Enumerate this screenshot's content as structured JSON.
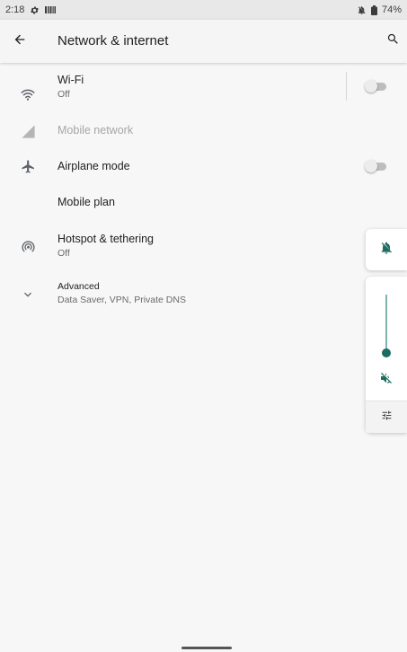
{
  "status_bar": {
    "time": "2:18",
    "battery": "74%",
    "icons": [
      "settings-gear-icon",
      "barcode-notification-icon",
      "notifications-off-icon",
      "battery-icon"
    ]
  },
  "header": {
    "title": "Network & internet",
    "back_icon": "back-arrow-icon",
    "search_icon": "search-icon"
  },
  "settings": {
    "wifi": {
      "title": "Wi-Fi",
      "summary": "Off",
      "icon": "wifi-icon",
      "toggle": "off"
    },
    "mobile_network": {
      "title": "Mobile network",
      "icon": "cellular-signal-icon",
      "enabled": false
    },
    "airplane_mode": {
      "title": "Airplane mode",
      "icon": "airplane-icon",
      "toggle": "off"
    },
    "mobile_plan": {
      "title": "Mobile plan"
    },
    "hotspot": {
      "title": "Hotspot & tethering",
      "summary": "Off",
      "icon": "hotspot-icon"
    },
    "advanced": {
      "title": "Advanced",
      "summary": "Data Saver, VPN, Private DNS",
      "icon": "chevron-down-icon"
    }
  },
  "volume_panel": {
    "ringer_icon": "ringer-off-icon",
    "mute_icon": "volume-mute-icon",
    "settings_icon": "sliders-icon",
    "level": 0,
    "accent": "#1e6b62"
  },
  "colors": {
    "background": "#f7f7f7",
    "status_bar": "#e8e8e8",
    "switch_track_off": "#bdbdbd",
    "accent": "#1e6b62"
  }
}
